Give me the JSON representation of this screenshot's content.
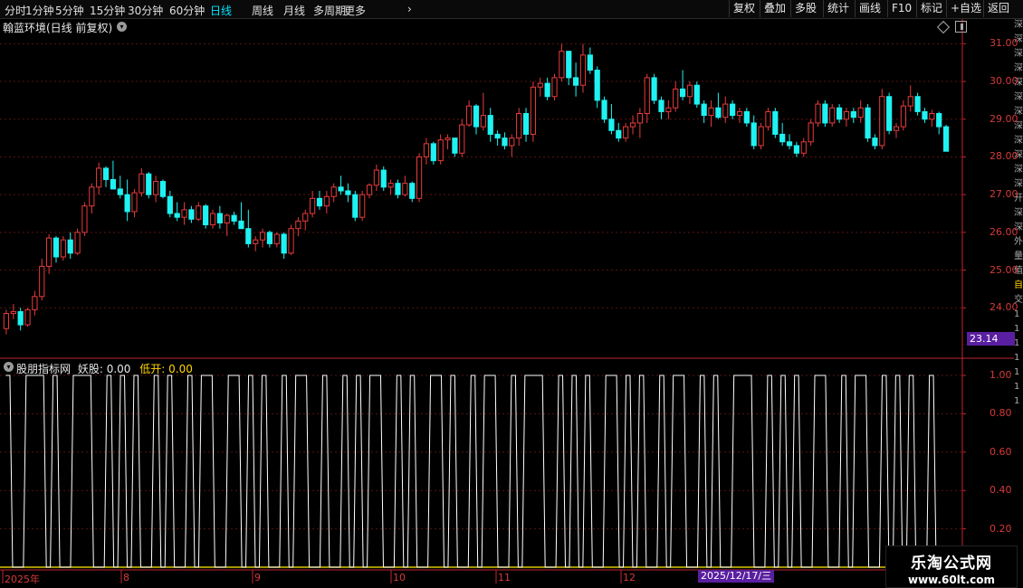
{
  "toolbar": {
    "periods": [
      "分时",
      "1分钟",
      "5分钟",
      "15分钟",
      "30分钟",
      "60分钟",
      "日线",
      "周线",
      "月线",
      "多周期",
      "更多"
    ],
    "active_period": "日线",
    "right_buttons": [
      "复权",
      "叠加",
      "多股",
      "统计",
      "画线",
      "F10",
      "标记",
      "+自选",
      "返回"
    ]
  },
  "price_panel": {
    "title": "翰蓝环境(日线 前复权)",
    "y_ticks": [
      "31.00",
      "30.00",
      "29.00",
      "28.00",
      "27.00",
      "26.00",
      "25.00",
      "24.00"
    ],
    "current_price": "23.14"
  },
  "indicator_panel": {
    "name": "股朋指标网",
    "label1": "妖股:",
    "value1": "0.00",
    "label2": "低开:",
    "value2": "0.00",
    "y_ticks": [
      "1.00",
      "0.80",
      "0.60",
      "0.40",
      "0.20"
    ]
  },
  "x_axis": {
    "labels": [
      "2025年",
      "8",
      "9",
      "10",
      "11",
      "12"
    ],
    "current_date": "2025/12/17/三"
  },
  "side_strip": [
    "深",
    "深",
    "深",
    "深",
    "深",
    "深",
    "深",
    "深",
    "深",
    "深",
    "深",
    "深",
    "开",
    "深",
    "深",
    "外",
    "量",
    "值",
    "自",
    "交",
    "1",
    "1",
    "1",
    "1",
    "1",
    "1",
    "1"
  ],
  "watermark": {
    "line1": "乐淘公式网",
    "line2": "www.60lt.com"
  },
  "colors": {
    "up": "#e83b3b",
    "down": "#1ff2f2",
    "indicator": "#ffffff",
    "axis": "#c0262f",
    "baseline": "#d9c800",
    "highlight": "#5a1fa0"
  },
  "chart_data": [
    {
      "type": "candlestick",
      "title": "翰蓝环境(日线 前复权)",
      "ylim": [
        23.0,
        31.2
      ],
      "ohlc": [
        [
          23.45,
          23.95,
          23.3,
          23.85
        ],
        [
          23.85,
          24.1,
          23.7,
          23.9
        ],
        [
          23.9,
          24.0,
          23.4,
          23.55
        ],
        [
          23.55,
          24.0,
          23.5,
          23.95
        ],
        [
          23.95,
          24.45,
          23.8,
          24.3
        ],
        [
          24.3,
          25.3,
          24.2,
          25.1
        ],
        [
          25.1,
          25.95,
          24.9,
          25.85
        ],
        [
          25.85,
          25.9,
          25.2,
          25.35
        ],
        [
          25.35,
          25.9,
          25.25,
          25.8
        ],
        [
          25.8,
          26.0,
          25.3,
          25.45
        ],
        [
          25.45,
          26.1,
          25.4,
          26.0
        ],
        [
          26.0,
          26.8,
          25.9,
          26.7
        ],
        [
          26.7,
          27.3,
          26.5,
          27.2
        ],
        [
          27.2,
          27.85,
          27.0,
          27.7
        ],
        [
          27.7,
          27.75,
          27.2,
          27.4
        ],
        [
          27.4,
          27.9,
          27.2,
          27.15
        ],
        [
          27.15,
          27.5,
          26.9,
          27.0
        ],
        [
          27.0,
          27.4,
          26.3,
          26.55
        ],
        [
          26.55,
          27.15,
          26.4,
          27.05
        ],
        [
          27.05,
          27.7,
          26.95,
          27.55
        ],
        [
          27.55,
          27.6,
          26.9,
          27.0
        ],
        [
          27.0,
          27.5,
          26.8,
          27.35
        ],
        [
          27.35,
          27.4,
          26.9,
          26.95
        ],
        [
          26.95,
          27.1,
          26.4,
          26.5
        ],
        [
          26.5,
          26.8,
          26.3,
          26.4
        ],
        [
          26.4,
          26.8,
          26.2,
          26.6
        ],
        [
          26.6,
          26.7,
          26.25,
          26.35
        ],
        [
          26.35,
          26.8,
          26.3,
          26.7
        ],
        [
          26.7,
          26.75,
          26.1,
          26.2
        ],
        [
          26.2,
          26.6,
          26.1,
          26.5
        ],
        [
          26.5,
          26.7,
          26.1,
          26.25
        ],
        [
          26.25,
          26.5,
          25.9,
          26.45
        ],
        [
          26.45,
          26.55,
          26.2,
          26.3
        ],
        [
          26.3,
          26.8,
          26.2,
          26.1
        ],
        [
          26.1,
          26.6,
          25.6,
          25.7
        ],
        [
          25.7,
          25.9,
          25.5,
          25.8
        ],
        [
          25.8,
          26.1,
          25.6,
          26.0
        ],
        [
          26.0,
          26.05,
          25.6,
          25.7
        ],
        [
          25.7,
          26.0,
          25.6,
          25.95
        ],
        [
          25.95,
          26.0,
          25.3,
          25.45
        ],
        [
          25.45,
          26.2,
          25.4,
          26.1
        ],
        [
          26.1,
          26.4,
          25.9,
          26.3
        ],
        [
          26.3,
          26.6,
          26.05,
          26.5
        ],
        [
          26.5,
          27.1,
          26.4,
          26.9
        ],
        [
          26.9,
          27.1,
          26.6,
          26.7
        ],
        [
          26.7,
          27.1,
          26.5,
          26.95
        ],
        [
          26.95,
          27.3,
          26.8,
          27.2
        ],
        [
          27.2,
          27.5,
          27.0,
          27.1
        ],
        [
          27.1,
          27.3,
          26.8,
          27.0
        ],
        [
          27.0,
          27.1,
          26.3,
          26.4
        ],
        [
          26.4,
          27.1,
          26.3,
          27.0
        ],
        [
          27.0,
          27.3,
          26.9,
          27.25
        ],
        [
          27.25,
          27.8,
          27.1,
          27.65
        ],
        [
          27.65,
          27.75,
          27.1,
          27.2
        ],
        [
          27.2,
          27.4,
          27.0,
          27.3
        ],
        [
          27.3,
          27.4,
          26.9,
          27.0
        ],
        [
          27.0,
          27.5,
          26.95,
          27.3
        ],
        [
          27.3,
          27.35,
          26.8,
          26.9
        ],
        [
          26.9,
          28.1,
          26.8,
          28.0
        ],
        [
          28.0,
          28.5,
          27.8,
          28.35
        ],
        [
          28.35,
          28.4,
          27.8,
          27.9
        ],
        [
          27.9,
          28.6,
          27.8,
          28.45
        ],
        [
          28.45,
          28.6,
          28.2,
          28.5
        ],
        [
          28.5,
          28.5,
          28.0,
          28.1
        ],
        [
          28.1,
          29.0,
          28.0,
          28.85
        ],
        [
          28.85,
          29.5,
          28.8,
          29.35
        ],
        [
          29.35,
          29.4,
          28.6,
          28.8
        ],
        [
          28.8,
          29.7,
          28.7,
          29.1
        ],
        [
          29.1,
          29.3,
          28.4,
          28.6
        ],
        [
          28.6,
          28.7,
          28.3,
          28.5
        ],
        [
          28.5,
          28.65,
          28.2,
          28.3
        ],
        [
          28.3,
          28.6,
          28.0,
          28.5
        ],
        [
          28.5,
          29.3,
          28.3,
          29.15
        ],
        [
          29.15,
          29.3,
          28.4,
          28.6
        ],
        [
          28.6,
          30.0,
          28.4,
          29.85
        ],
        [
          29.85,
          30.1,
          29.6,
          29.95
        ],
        [
          29.95,
          30.1,
          29.5,
          29.6
        ],
        [
          29.6,
          30.2,
          29.5,
          30.1
        ],
        [
          30.1,
          31.0,
          30.0,
          30.8
        ],
        [
          30.8,
          30.8,
          29.9,
          30.1
        ],
        [
          30.1,
          30.5,
          29.6,
          29.9
        ],
        [
          29.9,
          31.0,
          29.7,
          30.7
        ],
        [
          30.7,
          30.9,
          30.2,
          30.3
        ],
        [
          30.3,
          30.4,
          29.3,
          29.5
        ],
        [
          29.5,
          29.6,
          28.9,
          29.0
        ],
        [
          29.0,
          29.4,
          28.6,
          28.7
        ],
        [
          28.7,
          28.9,
          28.4,
          28.5
        ],
        [
          28.5,
          28.9,
          28.4,
          28.8
        ],
        [
          28.8,
          29.1,
          28.6,
          28.9
        ],
        [
          28.9,
          29.3,
          28.5,
          29.15
        ],
        [
          29.15,
          30.2,
          28.9,
          30.1
        ],
        [
          30.1,
          30.2,
          29.4,
          29.5
        ],
        [
          29.5,
          29.6,
          29.0,
          29.2
        ],
        [
          29.2,
          29.5,
          29.0,
          29.3
        ],
        [
          29.3,
          30.0,
          29.2,
          29.8
        ],
        [
          29.8,
          30.3,
          29.5,
          29.6
        ],
        [
          29.6,
          30.0,
          29.4,
          29.9
        ],
        [
          29.9,
          30.0,
          29.3,
          29.4
        ],
        [
          29.4,
          29.5,
          28.9,
          29.1
        ],
        [
          29.1,
          29.5,
          28.8,
          29.3
        ],
        [
          29.3,
          29.7,
          29.0,
          29.05
        ],
        [
          29.05,
          29.6,
          28.9,
          29.4
        ],
        [
          29.4,
          29.5,
          29.0,
          29.1
        ],
        [
          29.1,
          29.3,
          28.9,
          29.2
        ],
        [
          29.2,
          29.3,
          28.8,
          28.9
        ],
        [
          28.9,
          29.1,
          28.2,
          28.3
        ],
        [
          28.3,
          28.9,
          28.2,
          28.8
        ],
        [
          28.8,
          29.3,
          28.7,
          29.2
        ],
        [
          29.2,
          29.3,
          28.5,
          28.6
        ],
        [
          28.6,
          28.9,
          28.3,
          28.4
        ],
        [
          28.4,
          28.6,
          28.2,
          28.3
        ],
        [
          28.3,
          28.4,
          28.0,
          28.1
        ],
        [
          28.1,
          28.5,
          28.0,
          28.4
        ],
        [
          28.4,
          29.0,
          28.3,
          28.9
        ],
        [
          28.9,
          29.5,
          28.8,
          29.4
        ],
        [
          29.4,
          29.5,
          28.8,
          28.9
        ],
        [
          28.9,
          29.4,
          28.8,
          29.3
        ],
        [
          29.3,
          29.4,
          28.9,
          29.0
        ],
        [
          29.0,
          29.3,
          28.8,
          29.2
        ],
        [
          29.2,
          29.3,
          28.9,
          29.05
        ],
        [
          29.05,
          29.5,
          28.9,
          29.3
        ],
        [
          29.3,
          29.4,
          28.4,
          28.5
        ],
        [
          28.5,
          28.6,
          28.2,
          28.3
        ],
        [
          28.3,
          29.8,
          28.2,
          29.6
        ],
        [
          29.6,
          29.7,
          28.6,
          28.7
        ],
        [
          28.7,
          28.9,
          28.5,
          28.8
        ],
        [
          28.8,
          29.5,
          28.7,
          29.35
        ],
        [
          29.35,
          29.9,
          29.2,
          29.6
        ],
        [
          29.6,
          29.7,
          29.1,
          29.2
        ],
        [
          29.2,
          29.3,
          28.9,
          29.0
        ],
        [
          29.0,
          29.25,
          28.8,
          29.15
        ],
        [
          29.15,
          29.2,
          28.6,
          28.8
        ],
        [
          28.8,
          28.85,
          28.15,
          28.15
        ]
      ]
    },
    {
      "type": "line",
      "name": "妖股",
      "ylim": [
        0,
        1.0
      ],
      "values": [
        1,
        0,
        0,
        1,
        1,
        1,
        0,
        1,
        0,
        0,
        1,
        1,
        1,
        0,
        0,
        1,
        0,
        1,
        0,
        1,
        0,
        0,
        1,
        0,
        1,
        0,
        0,
        1,
        0,
        1,
        1,
        0,
        0,
        1,
        1,
        0,
        1,
        0,
        1,
        0,
        0,
        1,
        0,
        1,
        1,
        0,
        0,
        1,
        0,
        0,
        1,
        0,
        1,
        0,
        1,
        1,
        0,
        0,
        1,
        0,
        1,
        0,
        0,
        1,
        1,
        0,
        1,
        0,
        0,
        1,
        0,
        1,
        1,
        0,
        0,
        1,
        0,
        1,
        1,
        1,
        0,
        0,
        1,
        0,
        1,
        0,
        1,
        0,
        0,
        1,
        1,
        0,
        1,
        0,
        1,
        0,
        0,
        1,
        0,
        1,
        1,
        0,
        0,
        1,
        0,
        1,
        0,
        0,
        1,
        1,
        1,
        0,
        0,
        1,
        0,
        1,
        0,
        1,
        0,
        0,
        1,
        1,
        0,
        0,
        1,
        0,
        1,
        1,
        0,
        0,
        1,
        0,
        1,
        0,
        1,
        0,
        0,
        1,
        0
      ]
    }
  ]
}
